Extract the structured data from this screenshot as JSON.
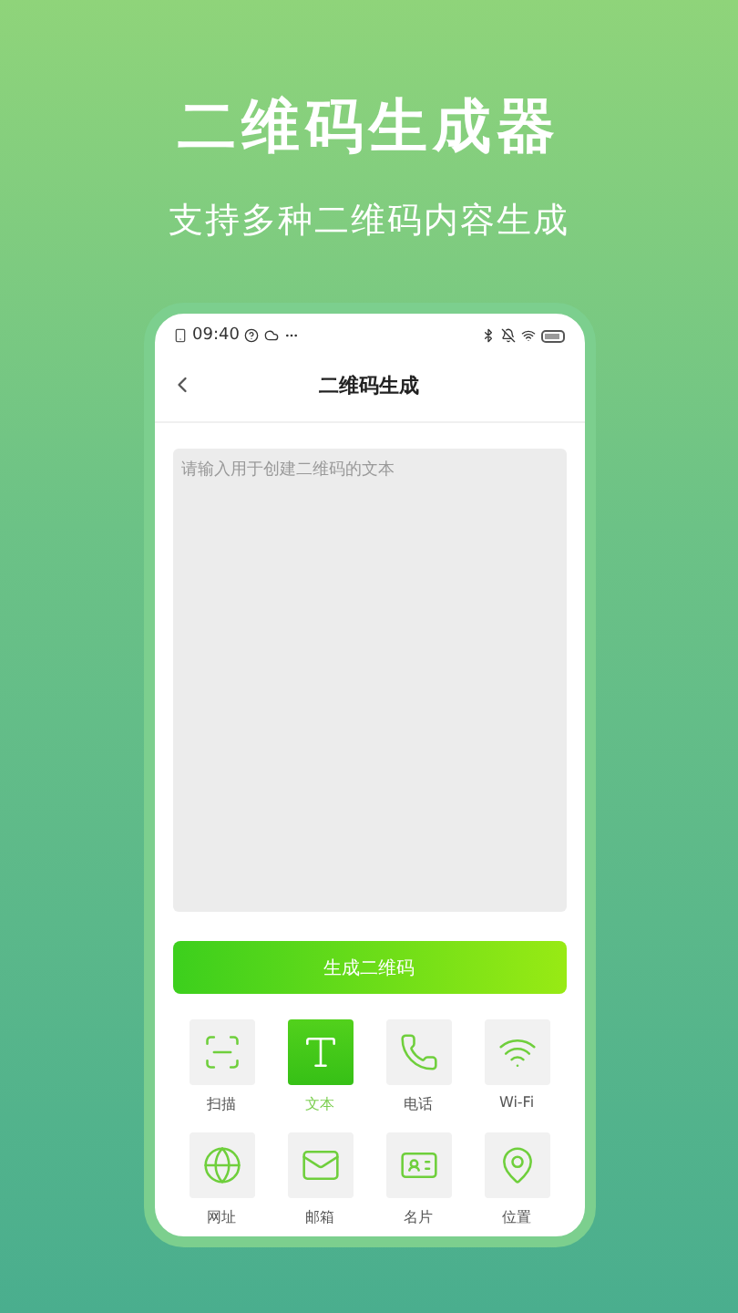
{
  "banner": {
    "title": "二维码生成器",
    "subtitle": "支持多种二维码内容生成"
  },
  "status_bar": {
    "time": "09:40"
  },
  "nav": {
    "title": "二维码生成"
  },
  "input": {
    "placeholder": "请输入用于创建二维码的文本"
  },
  "generate_button": "生成二维码",
  "types": [
    {
      "kind": "scan",
      "label": "扫描",
      "selected": false
    },
    {
      "kind": "text",
      "label": "文本",
      "selected": true
    },
    {
      "kind": "phone",
      "label": "电话",
      "selected": false
    },
    {
      "kind": "wifi",
      "label": "Wi-Fi",
      "selected": false
    },
    {
      "kind": "web",
      "label": "网址",
      "selected": false
    },
    {
      "kind": "mail",
      "label": "邮箱",
      "selected": false
    },
    {
      "kind": "card",
      "label": "名片",
      "selected": false
    },
    {
      "kind": "location",
      "label": "位置",
      "selected": false
    }
  ]
}
